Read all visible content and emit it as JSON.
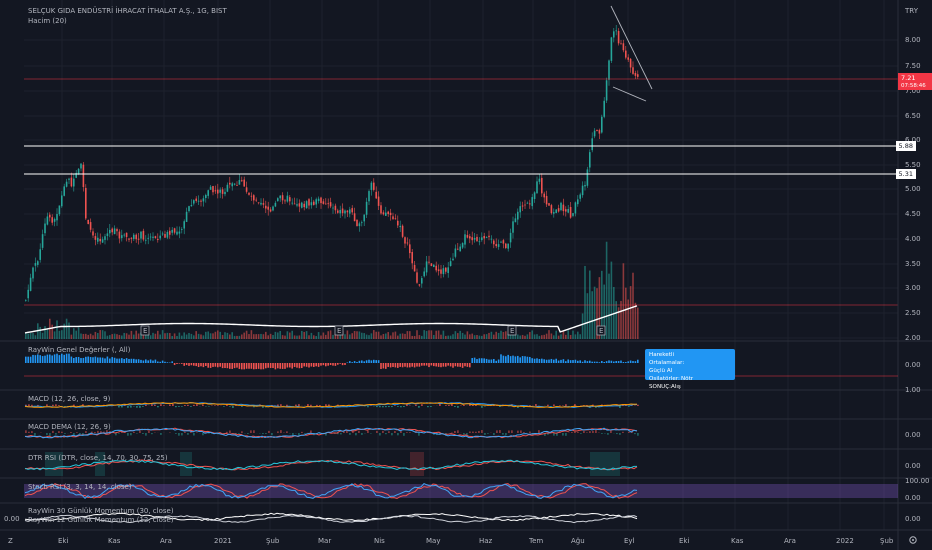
{
  "header": {
    "symbol_title": "SELÇUK GIDA ENDÜSTRİ İHRACAT İTHALAT A.Ş., 1G, BIST",
    "volume_label": "Hacim (20)",
    "currency": "TRY"
  },
  "price_axis": {
    "ticks": [
      "8.00",
      "7.50",
      "7.00",
      "6.50",
      "6.00",
      "5.50",
      "5.00",
      "4.50",
      "4.00",
      "3.50",
      "3.00",
      "2.50",
      "2.00"
    ],
    "last_price": "7.21",
    "countdown": "07:58:46",
    "level_1": "5.88",
    "level_2": "5.31",
    "colors": {
      "last_price_bg": "#f23645",
      "level_bg": "#ffffff"
    }
  },
  "time_axis": {
    "labels": [
      "Eki",
      "Kas",
      "Ara",
      "2021",
      "Şub",
      "Mar",
      "Nis",
      "May",
      "Haz",
      "Tem",
      "Ağu",
      "Eyl",
      "Eki",
      "Kas",
      "Ara",
      "2022",
      "Şub"
    ]
  },
  "earnings_markers": [
    "E",
    "E",
    "E",
    "E"
  ],
  "indicators": [
    {
      "id": "raywin",
      "title": "RayWin Genel Değerler (, All)",
      "value": "0.00"
    },
    {
      "id": "macd",
      "title": "MACD (12, 26, close, 9)",
      "value": "1.00"
    },
    {
      "id": "macd_dema",
      "title": "MACD DEMA (12, 26, 9)",
      "value": "0.00"
    },
    {
      "id": "rsi",
      "title": "DTR RSI (DTR, close, 14, 70, 30, 75, 25)",
      "value": "0.00"
    },
    {
      "id": "stoch",
      "title": "Stoch RSI (3, 3, 14, 14, close)",
      "value": "100.00",
      "value2": "0.00"
    },
    {
      "id": "momentum",
      "title": "RayWin 30 Günlük Momentum (30, close)",
      "title2": "RayWin 12 Günlük Momentum (12, close)",
      "value": "0.00",
      "value_left": "0.00"
    }
  ],
  "tooltip": {
    "row1_label": "Hareketli Ortalamalar:",
    "row1_value": "Güçlü Al",
    "row2_label": "Osilatörler:",
    "row2_value": "Nötr",
    "row3_label": "SONUÇ:",
    "row3_value": "Alış"
  },
  "corner": {
    "left_icon": "Z",
    "right_icon": "gear-icon"
  },
  "colors": {
    "up": "#26a69a",
    "down": "#ef5350",
    "bg": "#131722",
    "accent": "#2196f3"
  }
}
